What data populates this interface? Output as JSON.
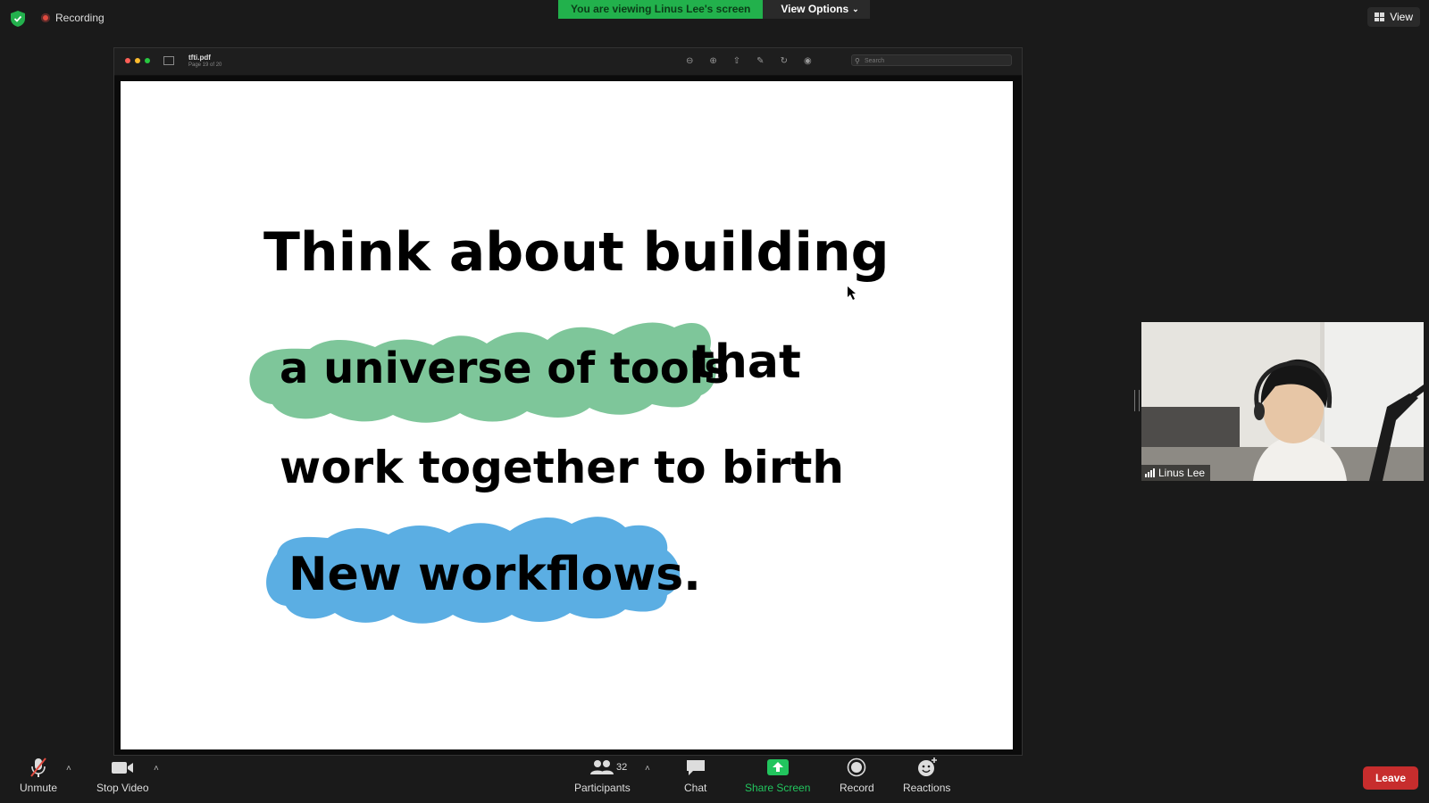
{
  "topbar": {
    "recording_label": "Recording",
    "banner_text": "You are viewing Linus Lee's screen",
    "view_options_label": "View Options",
    "view_label": "View"
  },
  "shared_window": {
    "doc_title": "tfti.pdf",
    "page_info": "Page 19 of 20",
    "search_placeholder": "Search"
  },
  "slide": {
    "line1": "Think about building",
    "line2_highlight": "a universe of tools",
    "line2_rest": "that",
    "line3": "work together to birth",
    "line4_highlight": "New workflows.",
    "colors": {
      "green_highlight": "#7ec69a",
      "blue_highlight": "#5baee3"
    }
  },
  "participant": {
    "name": "Linus Lee"
  },
  "controls": {
    "unmute": "Unmute",
    "stop_video": "Stop Video",
    "participants": "Participants",
    "participants_count": "32",
    "chat": "Chat",
    "share_screen": "Share Screen",
    "record": "Record",
    "reactions": "Reactions",
    "leave": "Leave"
  }
}
